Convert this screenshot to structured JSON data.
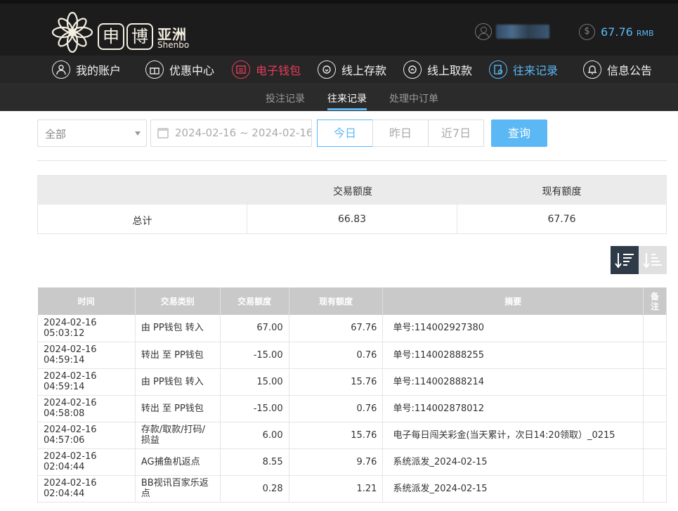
{
  "header": {
    "logo_char_1": "申",
    "logo_char_2": "博",
    "logo_asia": "亚洲",
    "logo_en": "Shenbo",
    "balance": "67.76",
    "balance_unit": "RMB"
  },
  "nav": {
    "items": [
      {
        "label": "我的账户",
        "icon": "user-icon",
        "state": "normal"
      },
      {
        "label": "优惠中心",
        "icon": "gift-icon",
        "state": "normal"
      },
      {
        "label": "电子钱包",
        "icon": "wallet-icon",
        "state": "red"
      },
      {
        "label": "线上存款",
        "icon": "deposit-icon",
        "state": "normal"
      },
      {
        "label": "线上取款",
        "icon": "withdraw-icon",
        "state": "normal"
      },
      {
        "label": "往来记录",
        "icon": "records-icon",
        "state": "active"
      },
      {
        "label": "信息公告",
        "icon": "bell-icon",
        "state": "normal"
      }
    ]
  },
  "subnav": {
    "items": [
      {
        "label": "投注记录",
        "active": false
      },
      {
        "label": "往来记录",
        "active": true
      },
      {
        "label": "处理中订单",
        "active": false
      }
    ]
  },
  "filters": {
    "type_select": "全部",
    "date_range": "2024-02-16 ~ 2024-02-16",
    "today": "今日",
    "yesterday": "昨日",
    "last7": "近7日",
    "query": "查询",
    "active_period": "today"
  },
  "summary": {
    "col_trans": "交易额度",
    "col_current": "现有额度",
    "row_label": "总计",
    "trans_total": "66.83",
    "current_total": "67.76"
  },
  "table": {
    "headers": [
      "时间",
      "交易类别",
      "交易额度",
      "现有额度",
      "摘要",
      "备注"
    ],
    "rows": [
      {
        "time": "2024-02-16 05:03:12",
        "type": "由 PP钱包 转入",
        "amount": "67.00",
        "balance": "67.76",
        "summary": "单号:114002927380",
        "note": ""
      },
      {
        "time": "2024-02-16 04:59:14",
        "type": "转出 至 PP钱包",
        "amount": "-15.00",
        "balance": "0.76",
        "summary": "单号:114002888255",
        "note": ""
      },
      {
        "time": "2024-02-16 04:59:14",
        "type": "由 PP钱包 转入",
        "amount": "15.00",
        "balance": "15.76",
        "summary": "单号:114002888214",
        "note": ""
      },
      {
        "time": "2024-02-16 04:58:08",
        "type": "转出 至 PP钱包",
        "amount": "-15.00",
        "balance": "0.76",
        "summary": "单号:114002878012",
        "note": ""
      },
      {
        "time": "2024-02-16 04:57:06",
        "type": "存款/取款/打码/损益",
        "amount": "6.00",
        "balance": "15.76",
        "summary": "电子每日闯关彩金(当天累计，次日14:20领取）_0215",
        "note": ""
      },
      {
        "time": "2024-02-16 02:04:44",
        "type": "AG捕鱼机返点",
        "amount": "8.55",
        "balance": "9.76",
        "summary": "系统派发_2024-02-15",
        "note": ""
      },
      {
        "time": "2024-02-16 02:04:44",
        "type": "BB视讯百家乐返点",
        "amount": "0.28",
        "balance": "1.21",
        "summary": "系统派发_2024-02-15",
        "note": ""
      }
    ]
  }
}
